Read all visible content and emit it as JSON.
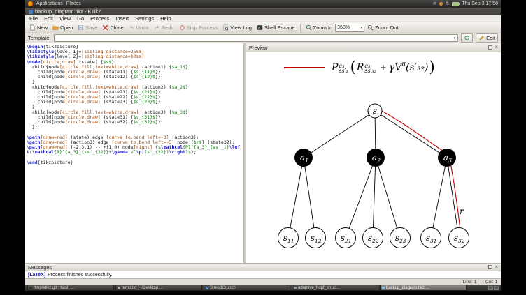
{
  "desktop": {
    "panel": {
      "apps": "Applications",
      "places": "Places",
      "clock": "Thu Sep 3 17:58"
    },
    "taskbar": {
      "windows": [
        {
          "label": "/tmp/ktikz.git : bash ...",
          "color": "#2f2f2f",
          "active": false
        },
        {
          "label": "temp.txt (~/Desktop ...",
          "color": "#a8a8a8",
          "active": false
        },
        {
          "label": "SpeedCrunch",
          "color": "#4a7fb5",
          "active": false
        },
        {
          "label": "adaptive_hopf_struc...",
          "color": "#8aa0a8",
          "active": false
        },
        {
          "label": "backup_diagram.tikz ...",
          "color": "#7fc0e8",
          "active": true
        }
      ]
    }
  },
  "window": {
    "title": "backup_diagram.tikz - KTikZ",
    "menubar": [
      "File",
      "Edit",
      "View",
      "Go",
      "Process",
      "Insert",
      "Settings",
      "Help"
    ],
    "toolbar": {
      "new": "New",
      "open": "Open",
      "save": "Save",
      "close": "Close",
      "undo": "Undo",
      "redo": "Redo",
      "stop": "Stop Process",
      "viewlog": "View Log",
      "shell": "Shell Escape",
      "zoom_in": "Zoom In",
      "zoom_value": "350%",
      "zoom_out": "Zoom Out"
    },
    "template": {
      "label": "Template:",
      "edit": "Edit"
    },
    "panes": {
      "preview": "Preview",
      "messages": "Messages"
    },
    "messages": {
      "tag": "[LaTeX]",
      "text": "Process finished successfully."
    },
    "status": {
      "line": "Line: 1",
      "col": "Col: 1"
    }
  },
  "editor": {
    "lines": [
      "\\begin{tikzpicture}",
      "\\tikzstyle{level 1}=[sibling distance=25mm]",
      "\\tikzstyle{level 2}=[sibling distance=10mm]",
      "\\node[circle,draw] (state) {$s$}",
      "  child{node[circle,fill,text=white,draw] (action1) {$a_1$}",
      "    child{node[circle,draw] (state11) {$s_{11}$}}",
      "    child{node[circle,draw] (state12) {$s_{12}$}}",
      "  }",
      "  child{node[circle,fill,text=white,draw] (action2) {$a_2$}",
      "    child{node[circle,draw] (state21) {$s_{21}$}}",
      "    child{node[circle,draw] (state22) {$s_{22}$}}",
      "    child{node[circle,draw] (state23) {$s_{23}$}}",
      "  }",
      "  child{node[circle,fill,text=white,draw] (action3) {$a_3$}",
      "    child{node[circle,draw] (state31) {$s_{31}$}}",
      "    child{node[circle,draw] (state32) {$s_{32}$}}",
      "  };",
      "",
      "\\path[draw=red] (state) edge [curve to,bend left=-3] (action3);",
      "\\path[draw=red] (action3) edge [curve to,bend left=-5] node {$r$} (state32);",
      "\\path[draw=red] (-2.3,1) -- +(1,0) node[right] {$\\mathcal{P}^{a_3}_{ss'_1}\\left(\\mathcal{R}^{a_3}_{ss'_{32}}+\\gamma V^\\pi(s'_{32})\\right)$};",
      "",
      "\\end{tikzpicture}"
    ]
  },
  "diagram": {
    "formula": {
      "p_base": "P",
      "p_sup": "a₃",
      "p_sub": "ss′₁",
      "open": "(",
      "r_base": "R",
      "r_sup": "a₃",
      "r_sub": "ss′₃₂",
      "plus": "+",
      "gamma": "γV",
      "pi": "π",
      "arg": "(s′₃₂)",
      "close": ")"
    },
    "edge_label": "r",
    "highlight_color": "#c00000",
    "nodes": {
      "root": "s",
      "a1m": "a",
      "a1s": "1",
      "a2m": "a",
      "a2s": "2",
      "a3m": "a",
      "a3s": "3",
      "s11m": "s",
      "s11s": "11",
      "s12m": "s",
      "s12s": "12",
      "s21m": "s",
      "s21s": "21",
      "s22m": "s",
      "s22s": "22",
      "s23m": "s",
      "s23s": "23",
      "s31m": "s",
      "s31s": "31",
      "s32m": "s",
      "s32s": "32"
    }
  }
}
